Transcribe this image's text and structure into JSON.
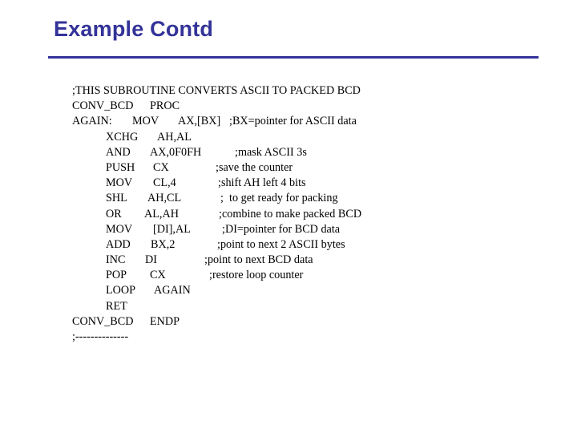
{
  "slide": {
    "title": "Example Contd",
    "accent_color": "#333399"
  },
  "code": {
    "lines": [
      {
        "label": ";THIS SUBROUTINE CONVERTS ASCII TO PACKED BCD",
        "op": "",
        "args": "",
        "comment": ""
      },
      {
        "label": "CONV_BCD",
        "op": "PROC",
        "args": "",
        "comment": ""
      },
      {
        "label": "AGAIN:",
        "op": "MOV",
        "args": "AX,[BX]",
        "comment": ";BX=pointer for ASCII data"
      },
      {
        "label": "",
        "op": "XCHG",
        "args": "AH,AL",
        "comment": ""
      },
      {
        "label": "",
        "op": "AND",
        "args": "AX,0F0FH",
        "comment": ";mask ASCII 3s"
      },
      {
        "label": "",
        "op": "PUSH",
        "args": "CX",
        "comment": ";save the counter"
      },
      {
        "label": "",
        "op": "MOV",
        "args": "CL,4",
        "comment": ";shift AH left 4 bits"
      },
      {
        "label": "",
        "op": "SHL",
        "args": "AH,CL",
        "comment": ";  to get ready for packing"
      },
      {
        "label": "",
        "op": "OR",
        "args": "AL,AH",
        "comment": ";combine to make packed BCD"
      },
      {
        "label": "",
        "op": "MOV",
        "args": "[DI],AL",
        "comment": ";DI=pointer for BCD data"
      },
      {
        "label": "",
        "op": "ADD",
        "args": "BX,2",
        "comment": ";point to next 2 ASCII bytes"
      },
      {
        "label": "",
        "op": "INC",
        "args": "DI",
        "comment": ";point to next BCD data"
      },
      {
        "label": "",
        "op": "POP",
        "args": "CX",
        "comment": ";restore loop counter"
      },
      {
        "label": "",
        "op": "LOOP",
        "args": "AGAIN",
        "comment": ""
      },
      {
        "label": "",
        "op": "RET",
        "args": "",
        "comment": ""
      },
      {
        "label": "CONV_BCD",
        "op": "ENDP",
        "args": "",
        "comment": ""
      },
      {
        "label": ";--------------",
        "op": "",
        "args": "",
        "comment": ""
      }
    ]
  }
}
